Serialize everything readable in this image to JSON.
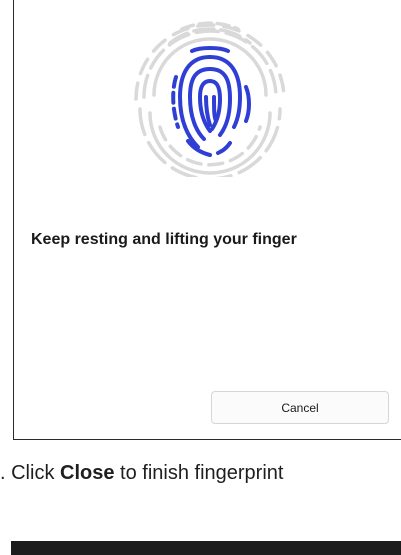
{
  "dialog": {
    "prompt": "Keep resting and lifting your finger",
    "cancel_label": "Cancel",
    "fingerprint_icon": "fingerprint-icon",
    "colors": {
      "active": "#2f3fd6",
      "inactive": "#d9d9d9"
    }
  },
  "instruction": {
    "prefix": ". Click ",
    "emphasis": "Close",
    "suffix": " to finish fingerprint"
  }
}
